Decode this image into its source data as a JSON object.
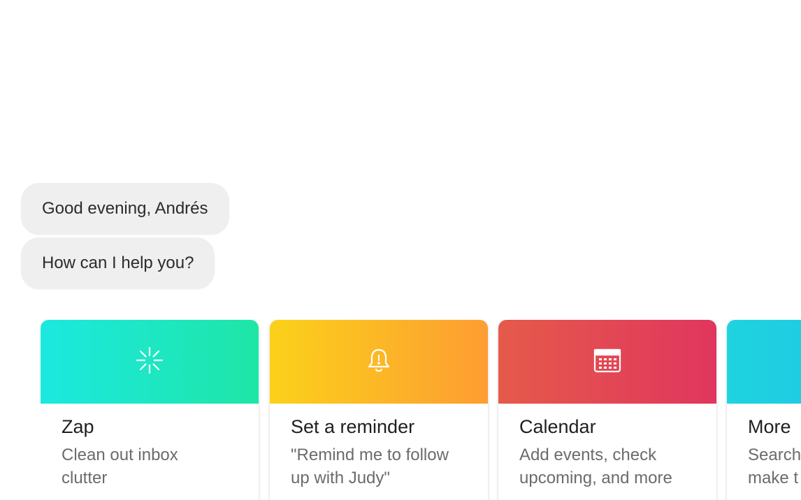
{
  "greeting": {
    "line1": "Good evening, Andrés",
    "line2": "How can I help you?"
  },
  "cards": [
    {
      "title": "Zap",
      "desc_line1": "Clean out inbox",
      "desc_line2": "clutter",
      "icon": "sparkle-burst-icon",
      "colors": [
        "#1ce8e0",
        "#1ee6a6"
      ]
    },
    {
      "title": "Set a reminder",
      "desc_line1": "\"Remind me to follow",
      "desc_line2": "up with Judy\"",
      "icon": "bell-alert-icon",
      "colors": [
        "#fbd11a",
        "#fd9d32"
      ]
    },
    {
      "title": "Calendar",
      "desc_line1": "Add events, check",
      "desc_line2": "upcoming, and more",
      "icon": "calendar-icon",
      "colors": [
        "#e55a4a",
        "#e0365e"
      ]
    },
    {
      "title": "More",
      "desc_line1": "Search",
      "desc_line2": "make t",
      "icon": "",
      "colors": [
        "#1fd3e0",
        "#1ec0e6"
      ]
    }
  ]
}
